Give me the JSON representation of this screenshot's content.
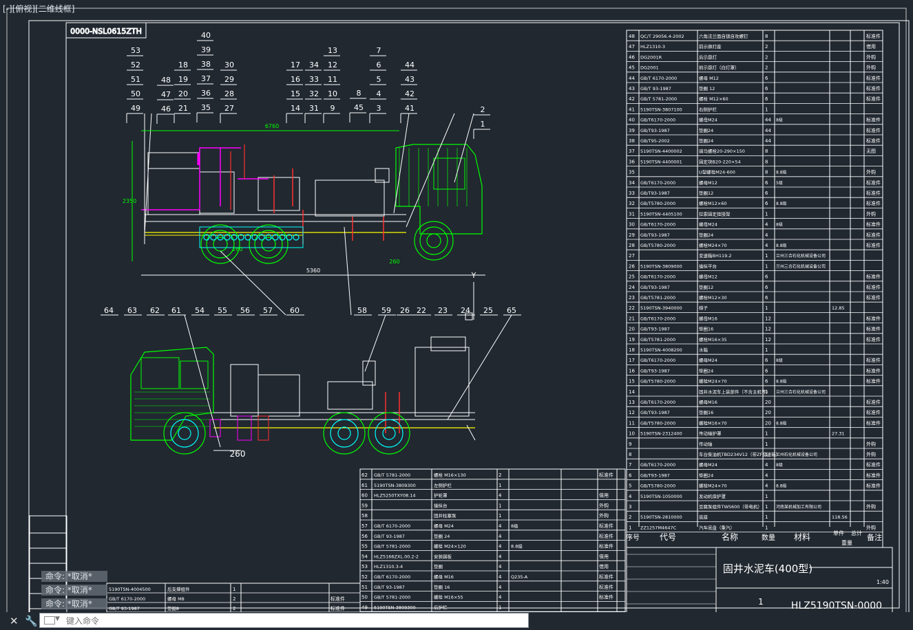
{
  "viewport_label": "[-][俯视][二维线框]",
  "drawing": {
    "title_topleft": "0000-NSL0615ZTH",
    "dims": {
      "d1": "6760",
      "d2": "5360",
      "d3": "2350",
      "d4": "260",
      "d5": "260",
      "d6": "260"
    },
    "axis_y": "Y",
    "top_callouts": {
      "c1": [
        "53",
        "52",
        "51",
        "50",
        "49"
      ],
      "c2": [
        "48",
        "47",
        "46"
      ],
      "c3": [
        "18",
        "19",
        "20",
        "21"
      ],
      "c4": [
        "40",
        "39",
        "38",
        "37",
        "36",
        "35"
      ],
      "c5": [
        "30",
        "29",
        "28",
        "27"
      ],
      "c6": [
        "17",
        "16",
        "15",
        "14"
      ],
      "c7": [
        "34",
        "33",
        "32",
        "31"
      ],
      "c8": [
        "13",
        "12",
        "11",
        "10",
        "9"
      ],
      "c9": [
        "8",
        "45"
      ],
      "c10": [
        "7",
        "6",
        "5",
        "4",
        "3"
      ],
      "c11": [
        "44",
        "43",
        "42",
        "41"
      ],
      "c12": [
        "2",
        "1"
      ]
    },
    "bottom_callouts": [
      "64",
      "63",
      "62",
      "61",
      "54",
      "55",
      "56",
      "57",
      "60",
      "58",
      "59",
      "26",
      "22",
      "23",
      "24",
      "25",
      "65"
    ],
    "parts_right": [
      [
        "48",
        "QC/T 29056.4-2002",
        "六角法兰面自锁自攻螺钉",
        "8",
        "",
        "",
        "标准件"
      ],
      [
        "47",
        "HLZ1310-3",
        "前示廓灯座",
        "2",
        "",
        "",
        "借用"
      ],
      [
        "46",
        "DG2001R",
        "后示廓灯",
        "2",
        "",
        "",
        "外购"
      ],
      [
        "45",
        "DG2001",
        "前示廓灯（白灯罩）",
        "2",
        "",
        "",
        "外购"
      ],
      [
        "44",
        "GB/T 6170-2000",
        "螺母 M12",
        "6",
        "",
        "",
        "标准件"
      ],
      [
        "43",
        "GB/T 93-1987",
        "垫圈 12",
        "6",
        "",
        "",
        "标准件"
      ],
      [
        "42",
        "GB/T 5781-2000",
        "螺栓 M12×60",
        "6",
        "",
        "",
        "标准件"
      ],
      [
        "41",
        "5190TSN-3807100",
        "右侧护栏",
        "1",
        "",
        "",
        ""
      ],
      [
        "40",
        "GB/T6170-2000",
        "螺母M24",
        "44",
        "8级",
        "",
        "标准件"
      ],
      [
        "39",
        "GB/T93-1987",
        "垫圈24",
        "44",
        "",
        "",
        "标准件"
      ],
      [
        "38",
        "GB/T95-2002",
        "垫圈24",
        "44",
        "",
        "",
        "标准件"
      ],
      [
        "37",
        "5190TSN-4400002",
        "骑马螺栓20-290×150",
        "8",
        "",
        "",
        "无图"
      ],
      [
        "36",
        "5190TSN-4400001",
        "固定块B20-220×54",
        "8",
        "",
        "",
        ""
      ],
      [
        "35",
        "",
        "U型螺栓M24-600",
        "8",
        "8.8级",
        "",
        "外购"
      ],
      [
        "34",
        "GB/T6170-2000",
        "螺母M12",
        "6",
        "5级",
        "",
        "标准件"
      ],
      [
        "33",
        "GB/T93-1987",
        "垫圈12",
        "6",
        "",
        "",
        "标准件"
      ],
      [
        "32",
        "GB/T5780-2000",
        "螺栓M12×60",
        "6",
        "8.8级",
        "",
        "标准件"
      ],
      [
        "31",
        "5190TSN-4405100",
        "拉索固定挂接架",
        "1",
        "",
        "",
        "外购"
      ],
      [
        "30",
        "GB/T6170-2000",
        "螺母M24",
        "4",
        "8级",
        "",
        "标准件"
      ],
      [
        "29",
        "GB/T93-1987",
        "垫圈24",
        "4",
        "",
        "",
        "标准件"
      ],
      [
        "28",
        "GB/T5780-2000",
        "螺栓M24×70",
        "4",
        "8.8级",
        "",
        "标准件"
      ],
      [
        "27",
        "",
        "变速箱BH119.2",
        "1",
        "兰州三合石化机械设备公司",
        "",
        ""
      ],
      [
        "26",
        "5190TSN-3809000",
        "操纵平台",
        "1",
        "兰州三合石化机械设备公司",
        "",
        ""
      ],
      [
        "25",
        "GB/T6170-2000",
        "螺母M12",
        "6",
        "",
        "",
        "标准件"
      ],
      [
        "24",
        "GB/T93-1987",
        "垫圈12",
        "6",
        "",
        "",
        "标准件"
      ],
      [
        "23",
        "GB/T5781-2000",
        "螺栓M12×30",
        "6",
        "",
        "",
        "标准件"
      ],
      [
        "22",
        "5190TSN-3940000",
        "梯子",
        "1",
        "",
        "12.85",
        ""
      ],
      [
        "21",
        "GB/T6170-2000",
        "螺母M16",
        "12",
        "",
        "",
        "标准件"
      ],
      [
        "20",
        "GB/T93-1987",
        "垫圈16",
        "12",
        "",
        "",
        "标准件"
      ],
      [
        "19",
        "GB/T5781-2000",
        "螺栓M16×35",
        "12",
        "",
        "",
        "标准件"
      ],
      [
        "18",
        "5190TSN-4008200",
        "水箱",
        "1",
        "",
        "",
        ""
      ],
      [
        "17",
        "GB/T6170-2000",
        "螺母M24",
        "6",
        "8级",
        "",
        "标准件"
      ],
      [
        "16",
        "GB/T93-1987",
        "垫圈24",
        "6",
        "",
        "",
        "标准件"
      ],
      [
        "15",
        "GB/T5780-2000",
        "螺栓M24×70",
        "6",
        "8.8级",
        "",
        "标准件"
      ],
      [
        "14",
        "",
        "固井水泥车上装部件（不含主机等）",
        "1",
        "兰州三合石化机械设备公司",
        "",
        ""
      ],
      [
        "13",
        "GB/T6170-2000",
        "螺母M16",
        "20",
        "",
        "",
        "标准件"
      ],
      [
        "12",
        "GB/T93-1987",
        "垫圈16",
        "20",
        "",
        "",
        "标准件"
      ],
      [
        "11",
        "GB/T5780-2000",
        "螺栓M16×70",
        "20",
        "8.8级",
        "",
        "标准件"
      ],
      [
        "10",
        "5190TSN-2312400",
        "传动轴护罩",
        "1",
        "",
        "27.31",
        ""
      ],
      [
        "9",
        "",
        "传动轴",
        "1",
        "",
        "",
        "外购"
      ],
      [
        "8",
        "",
        "车台柴油机TBD234V12（带ZF变速箱）",
        "1",
        "兰州石化机械设备公司",
        "",
        "外购"
      ],
      [
        "7",
        "GB/T6170-2000",
        "螺母M24",
        "4",
        "8级",
        "",
        "标准件"
      ],
      [
        "6",
        "GB/T93-1987",
        "垫圈24",
        "4",
        "",
        "",
        "标准件"
      ],
      [
        "5",
        "GB/T5780-2000",
        "螺栓M24×70",
        "4",
        "8.8级",
        "",
        "标准件"
      ],
      [
        "4",
        "5190TSN-1050000",
        "发动机保护罩",
        "1",
        "",
        "",
        ""
      ],
      [
        "3",
        "",
        "豆腐泵组件TWS600（带电机）",
        "1",
        "河南某机械加工有限公司",
        "",
        "外购"
      ],
      [
        "2",
        "5190TSN-2810000",
        "底座",
        "1",
        "",
        "118.56",
        ""
      ],
      [
        "1",
        "ZZ1257M4647C",
        "汽车底盘（重汽）",
        "1",
        "",
        "",
        "外购"
      ]
    ],
    "header_right": {
      "seq": "序号",
      "code": "代号",
      "name": "名称",
      "qty": "数量",
      "material": "材料",
      "unit": "单件",
      "total": "总计",
      "weight": "重量",
      "remark": "备注"
    },
    "title_block": {
      "title": "固井水泥车(400型)",
      "sheet": "1",
      "drawing_no": "HLZ5190TSN-0000",
      "scale": "1:40"
    },
    "parts_mid": [
      [
        "62",
        "GB/T 5781-2000",
        "螺栓 M16×130",
        "2",
        "",
        "",
        "标准件"
      ],
      [
        "61",
        "5190TSN-3809300",
        "左侧护栏",
        "1",
        "",
        "",
        ""
      ],
      [
        "60",
        "HLZ5250TXY08.14",
        "护轮罩",
        "4",
        "",
        "",
        "借用"
      ],
      [
        "59",
        "",
        "操纵台",
        "1",
        "",
        "",
        "外购"
      ],
      [
        "58",
        "",
        "固井柱塞泵",
        "1",
        "",
        "",
        "外购"
      ],
      [
        "57",
        "GB/T 6170-2000",
        "螺母 M24",
        "4",
        "8级",
        "",
        "标准件"
      ],
      [
        "56",
        "GB/T 93-1987",
        "垫圈 24",
        "4",
        "",
        "",
        "标准件"
      ],
      [
        "55",
        "GB/T 5781-2000",
        "螺栓 M24×120",
        "4",
        "8.8级",
        "",
        "标准件"
      ],
      [
        "54",
        "HLZ5166ZXL.00.2-2",
        "安装圆板",
        "4",
        "",
        "",
        "借用"
      ],
      [
        "53",
        "HLZ1310.3-4",
        "垫圈",
        "4",
        "",
        "",
        "借用"
      ],
      [
        "52",
        "GB/T 6170-2000",
        "螺母 M16",
        "4",
        "Q235-A",
        "",
        "标准件"
      ],
      [
        "51",
        "GB/T 93-1987",
        "垫圈 16",
        "4",
        "",
        "",
        "标准件"
      ],
      [
        "50",
        "GB/T 5781-2000",
        "螺栓 M16×55",
        "4",
        "",
        "",
        "标准件"
      ],
      [
        "49",
        "5190TSN-3809300",
        "后护栏",
        "1",
        "",
        "",
        ""
      ]
    ],
    "parts_left": [
      [
        "5190TSN-4004500",
        "后支撑组件",
        "1",
        ""
      ],
      [
        "GB/T 6170-2000",
        "螺母 M8",
        "2",
        "标准件"
      ],
      [
        "GB/T 93-1987",
        "垫圈8",
        "2",
        "标准件"
      ]
    ]
  },
  "command_history": [
    "命令: *取消*",
    "命令: *取消*",
    "命令: *取消*"
  ],
  "command_input": {
    "placeholder": "键入命令"
  },
  "colors": {
    "background": "#212830",
    "frame": "#ffffff",
    "truck": "#00ff00",
    "chassis": "#00ffff",
    "pipes": "#ff00ff",
    "axis_line": "#ffff00",
    "dims": "#00ff00",
    "red": "#ff3030"
  }
}
